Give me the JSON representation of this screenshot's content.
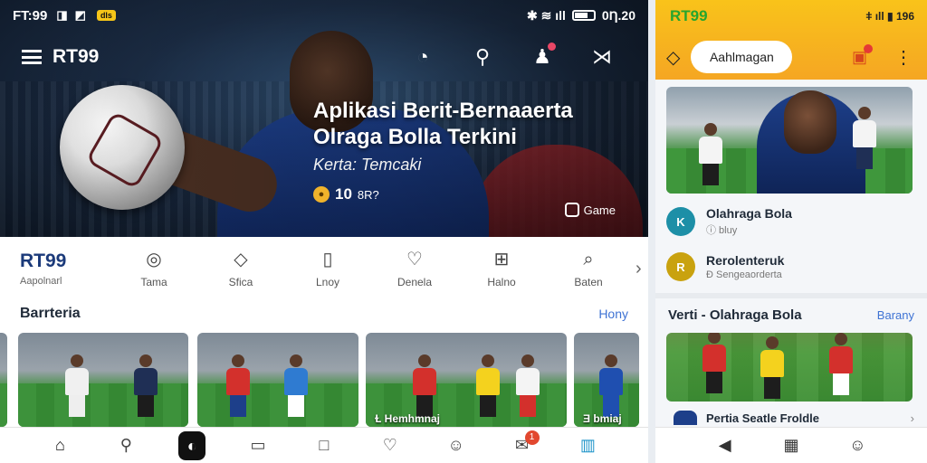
{
  "left": {
    "status": {
      "time": "FT:99",
      "icon_left_1": "◨",
      "icon_left_2": "◩",
      "badge": "dls",
      "right_text": "0Ƞ.20"
    },
    "appbar": {
      "brand": "RT99",
      "icons": [
        "chat-bubble-icon",
        "search-icon",
        "notification-icon",
        "share-icon"
      ]
    },
    "hero": {
      "title": "Aplikasi Berit-Bernaaerta Olraga Bolla Terkini",
      "subtitle": "Kerta: Temcaki",
      "meta_value": "10",
      "meta_unit": "8R?",
      "game_label": "Game"
    },
    "categories": {
      "brand": "RT99",
      "brand_sub": "Aapolnarl",
      "items": [
        {
          "icon": "◎",
          "label": "Tama"
        },
        {
          "icon": "◇",
          "label": "Sfica"
        },
        {
          "icon": "▯",
          "label": "Lnoy"
        },
        {
          "icon": "♡",
          "label": "Denela"
        },
        {
          "icon": "⊞",
          "label": "Halno"
        },
        {
          "icon": "⌕",
          "label": "Baten"
        }
      ],
      "next": "›"
    },
    "section": {
      "title": "Barrteria",
      "link": "Hony"
    },
    "thumbs": [
      {
        "caption": ""
      },
      {
        "caption": ""
      },
      {
        "caption": "Ɫ Hemhmnaj"
      },
      {
        "caption": "Ǝ bmiaj"
      }
    ],
    "bottom_nav": {
      "items": [
        "home-icon",
        "search-icon",
        "center-app-icon",
        "tablet-icon",
        "square-icon",
        "heart-icon",
        "user-icon",
        "message-icon",
        "stats-icon"
      ],
      "badge": "1"
    }
  },
  "right": {
    "status": {
      "brand": "RT99",
      "right_text": "ǂ ıll ▮ 196"
    },
    "bar": {
      "pill": "Aahlmagan"
    },
    "list": [
      {
        "title": "Olahraga Bola",
        "sub": "ⓘ bluy",
        "icon_text": "K",
        "color": "#1d8fa7"
      },
      {
        "title": "Rerolenteruk",
        "sub": "Ɖ Sengeaorderta",
        "icon_text": "R",
        "color": "#c9a20f"
      }
    ],
    "section": {
      "title": "Verti - Olahraga Bola",
      "link": "Barany"
    },
    "row": {
      "label": "Pertia Seatle Froldle",
      "chev": "›"
    },
    "nav": {
      "items": [
        "back-icon",
        "grid-icon",
        "profile-icon"
      ]
    }
  }
}
